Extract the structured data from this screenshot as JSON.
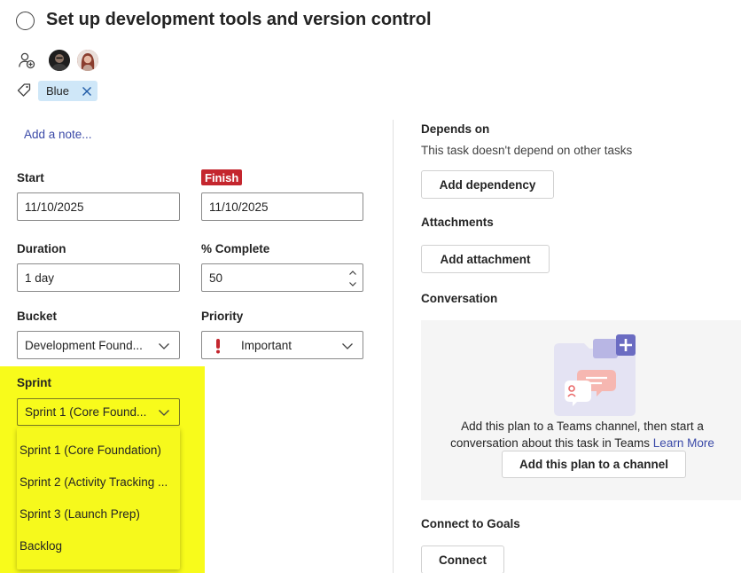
{
  "task": {
    "title": "Set up development tools and version control"
  },
  "labels": [
    {
      "name": "Blue",
      "color": "#cfe7f8"
    }
  ],
  "note": {
    "placeholder": "Add a note..."
  },
  "fields": {
    "start_label": "Start",
    "start_value": "11/10/2025",
    "finish_label": "Finish",
    "finish_value": "11/10/2025",
    "duration_label": "Duration",
    "duration_value": "1 day",
    "complete_label": "% Complete",
    "complete_value": "50",
    "bucket_label": "Bucket",
    "bucket_value": "Development Found...",
    "priority_label": "Priority",
    "priority_value": "Important",
    "sprint_label": "Sprint",
    "sprint_value": "Sprint 1 (Core Found..."
  },
  "sprint_options": [
    "Sprint 1 (Core Foundation)",
    "Sprint 2 (Activity Tracking ...",
    "Sprint 3 (Launch Prep)",
    "Backlog"
  ],
  "depends": {
    "title": "Depends on",
    "description": "This task doesn't depend on other tasks",
    "button": "Add dependency"
  },
  "attachments": {
    "title": "Attachments",
    "button": "Add attachment"
  },
  "conversation": {
    "title": "Conversation",
    "text_line1": "Add this plan to a Teams channel, then start a",
    "text_line2": "conversation about this task in Teams",
    "learn_more": "Learn More",
    "button": "Add this plan to a channel"
  },
  "goals": {
    "title": "Connect to Goals",
    "button": "Connect"
  },
  "colors": {
    "highlight": "#f8fb1b",
    "finish_badge": "#c4262e",
    "link": "#3b4aa8",
    "priority_icon": "#c4262e"
  },
  "icons": {
    "complete": "circle-icon",
    "assign": "add-person-icon",
    "label": "tag-icon",
    "remove_label": "close-icon",
    "dropdown": "chevron-down-icon",
    "priority": "exclamation-icon"
  }
}
